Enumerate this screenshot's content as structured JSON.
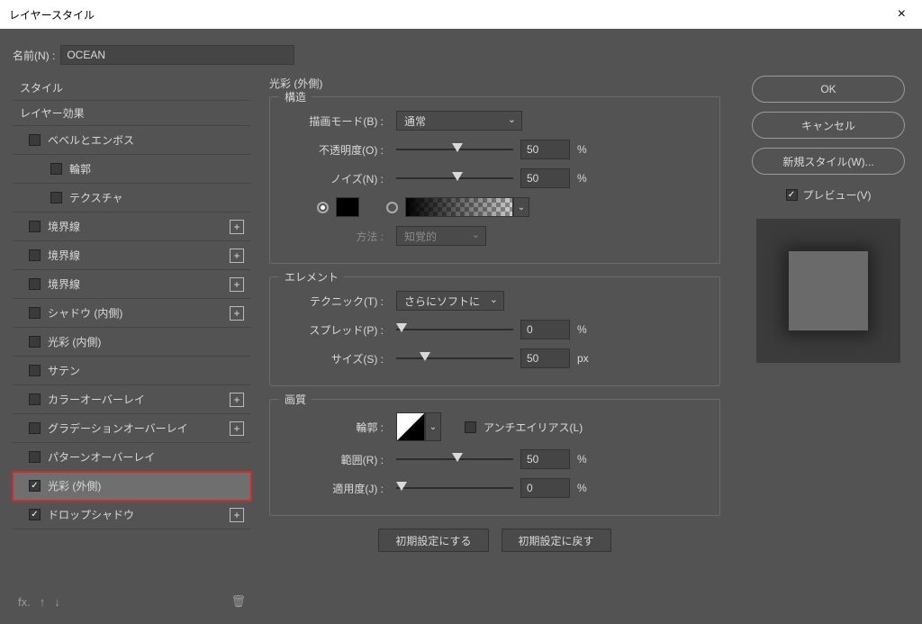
{
  "window": {
    "title": "レイヤースタイル",
    "close_icon": "×"
  },
  "name": {
    "label": "名前(N) :",
    "value": "OCEAN"
  },
  "left": {
    "styles_header": "スタイル",
    "layer_effects_header": "レイヤー効果",
    "items": [
      {
        "label": "ベベルとエンボス",
        "checked": false,
        "plus": false,
        "sub": false
      },
      {
        "label": "輪郭",
        "checked": false,
        "plus": false,
        "sub": true
      },
      {
        "label": "テクスチャ",
        "checked": false,
        "plus": false,
        "sub": true
      },
      {
        "label": "境界線",
        "checked": false,
        "plus": true,
        "sub": false
      },
      {
        "label": "境界線",
        "checked": false,
        "plus": true,
        "sub": false
      },
      {
        "label": "境界線",
        "checked": false,
        "plus": true,
        "sub": false
      },
      {
        "label": "シャドウ (内側)",
        "checked": false,
        "plus": true,
        "sub": false
      },
      {
        "label": "光彩 (内側)",
        "checked": false,
        "plus": false,
        "sub": false
      },
      {
        "label": "サテン",
        "checked": false,
        "plus": false,
        "sub": false
      },
      {
        "label": "カラーオーバーレイ",
        "checked": false,
        "plus": true,
        "sub": false
      },
      {
        "label": "グラデーションオーバーレイ",
        "checked": false,
        "plus": true,
        "sub": false
      },
      {
        "label": "パターンオーバーレイ",
        "checked": false,
        "plus": false,
        "sub": false
      },
      {
        "label": "光彩 (外側)",
        "checked": true,
        "plus": false,
        "sub": false,
        "selected": true
      },
      {
        "label": "ドロップシャドウ",
        "checked": true,
        "plus": true,
        "sub": false
      }
    ],
    "bottom": {
      "fx": "fx.",
      "up": "↑",
      "down": "↓",
      "trash": "🗑"
    }
  },
  "panel": {
    "title": "光彩 (外側)",
    "structure": {
      "legend": "構造",
      "blend_mode_label": "描画モード(B) :",
      "blend_mode_value": "通常",
      "opacity_label": "不透明度(O) :",
      "opacity_value": "50",
      "opacity_unit": "%",
      "noise_label": "ノイズ(N) :",
      "noise_value": "50",
      "noise_unit": "%",
      "method_label": "方法 :",
      "method_value": "知覚的"
    },
    "element": {
      "legend": "エレメント",
      "technique_label": "テクニック(T) :",
      "technique_value": "さらにソフトに",
      "spread_label": "スプレッド(P) :",
      "spread_value": "0",
      "spread_unit": "%",
      "size_label": "サイズ(S) :",
      "size_value": "50",
      "size_unit": "px"
    },
    "quality": {
      "legend": "画質",
      "contour_label": "輪郭 :",
      "antialias_label": "アンチエイリアス(L)",
      "range_label": "範囲(R) :",
      "range_value": "50",
      "range_unit": "%",
      "jitter_label": "適用度(J) :",
      "jitter_value": "0",
      "jitter_unit": "%"
    },
    "buttons": {
      "default_set": "初期設定にする",
      "default_reset": "初期設定に戻す"
    }
  },
  "right": {
    "ok": "OK",
    "cancel": "キャンセル",
    "new_style": "新規スタイル(W)...",
    "preview_label": "プレビュー(V)"
  }
}
